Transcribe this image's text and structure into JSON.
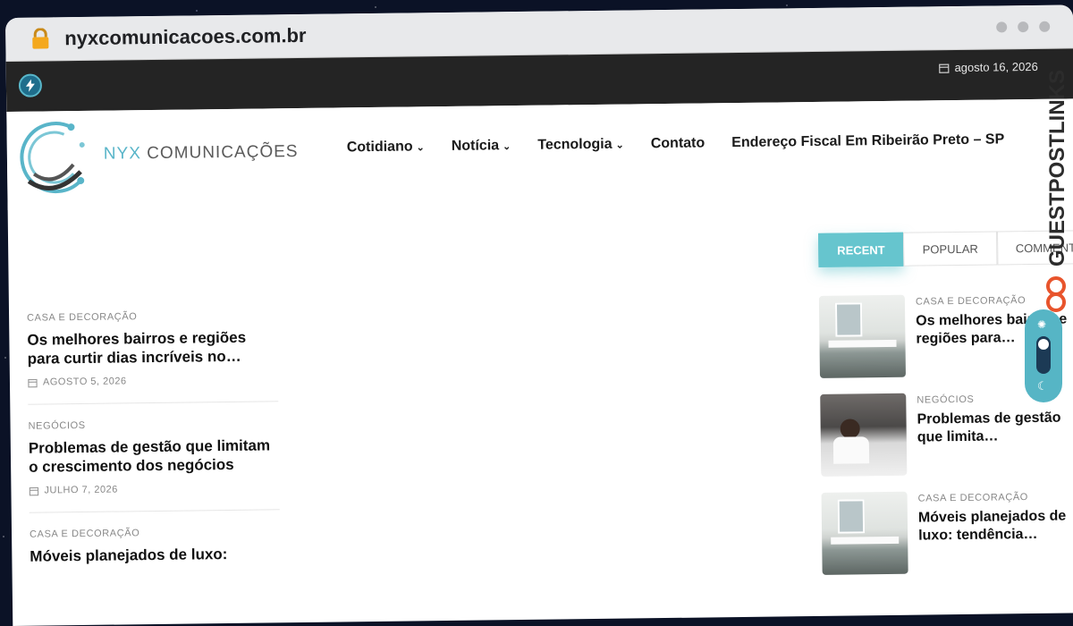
{
  "browser": {
    "url": "nyxcomunicacoes.com.br"
  },
  "topbar": {
    "date": "agosto 16, 2026"
  },
  "header": {
    "brand_prefix": "NYX",
    "brand_suffix": " COMUNICAÇÕES",
    "nav": [
      {
        "label": "Cotidiano",
        "has_dropdown": true
      },
      {
        "label": "Notícia",
        "has_dropdown": true
      },
      {
        "label": "Tecnologia",
        "has_dropdown": true
      },
      {
        "label": "Contato",
        "has_dropdown": false
      },
      {
        "label": "Endereço Fiscal Em Ribeirão Preto – SP",
        "has_dropdown": false
      }
    ]
  },
  "tabs": [
    {
      "label": "RECENT",
      "active": true
    },
    {
      "label": "POPULAR",
      "active": false
    },
    {
      "label": "COMMENTS",
      "active": false
    }
  ],
  "articles": [
    {
      "category": "CASA E DECORAÇÃO",
      "title": "Os melhores bairros e regiões para curtir dias incríveis no…",
      "date": "AGOSTO 5, 2026"
    },
    {
      "category": "NEGÓCIOS",
      "title": "Problemas de gestão que limitam o crescimento dos negócios",
      "date": "JULHO 7, 2026"
    },
    {
      "category": "CASA E DECORAÇÃO",
      "title": "Móveis planejados de luxo:",
      "date": ""
    }
  ],
  "sidebar": [
    {
      "category": "CASA E DECORAÇÃO",
      "title": "Os melhores bairros e regiões para…",
      "thumb": "kitchen"
    },
    {
      "category": "NEGÓCIOS",
      "title": "Problemas de gestão que limita…",
      "thumb": "office"
    },
    {
      "category": "CASA E DECORAÇÃO",
      "title": "Móveis planejados de luxo: tendência…",
      "thumb": "kitchen"
    }
  ],
  "watermark": "GUESTPOSTLINKS",
  "colors": {
    "accent": "#66c5ce",
    "topbar": "#242424",
    "brand": "#59b5c9"
  }
}
